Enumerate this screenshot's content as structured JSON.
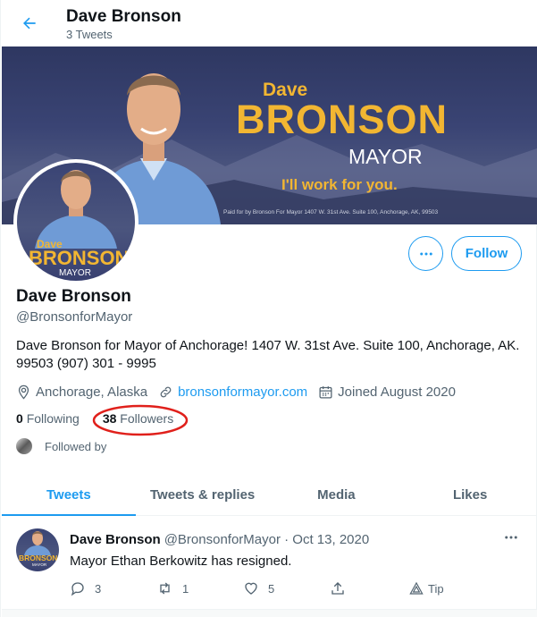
{
  "header": {
    "title": "Dave Bronson",
    "subtitle": "3 Tweets"
  },
  "banner": {
    "first_name": "Dave",
    "last_name": "BRONSON",
    "office": "MAYOR",
    "slogan": "I'll work for you.",
    "disclaimer": "Paid for by Bronson For Mayor 1407 W. 31st Ave. Suite 100, Anchorage, AK, 99503"
  },
  "avatar": {
    "first_name": "Dave",
    "last_name": "BRONSON",
    "office": "MAYOR"
  },
  "buttons": {
    "more": "more-icon",
    "follow_label": "Follow"
  },
  "profile": {
    "name": "Dave Bronson",
    "handle": "@BronsonforMayor",
    "bio": "Dave Bronson for Mayor of Anchorage! 1407 W. 31st Ave. Suite 100, Anchorage, AK. 99503 (907) 301 - 9995",
    "location": "Anchorage, Alaska",
    "website": "bronsonformayor.com",
    "joined": "Joined August 2020",
    "following_count": "0",
    "following_label": "Following",
    "followers_count": "38",
    "followers_label": "Followers",
    "followed_by": "Followed by"
  },
  "tabs": [
    {
      "label": "Tweets",
      "active": true
    },
    {
      "label": "Tweets & replies",
      "active": false
    },
    {
      "label": "Media",
      "active": false
    },
    {
      "label": "Likes",
      "active": false
    }
  ],
  "tweet": {
    "avatar_text": "BRONSON",
    "avatar_office": "MAYOR",
    "name": "Dave Bronson",
    "meta": "@BronsonforMayor · Oct 13, 2020",
    "text": "Mayor Ethan Berkowitz has resigned.",
    "replies": "3",
    "retweets": "1",
    "likes": "5",
    "tip_label": "Tip"
  },
  "colors": {
    "accent": "#1d9bf0",
    "annotation": "#e0201b",
    "gold": "#f2b632",
    "banner_bg": "#3a4474"
  }
}
